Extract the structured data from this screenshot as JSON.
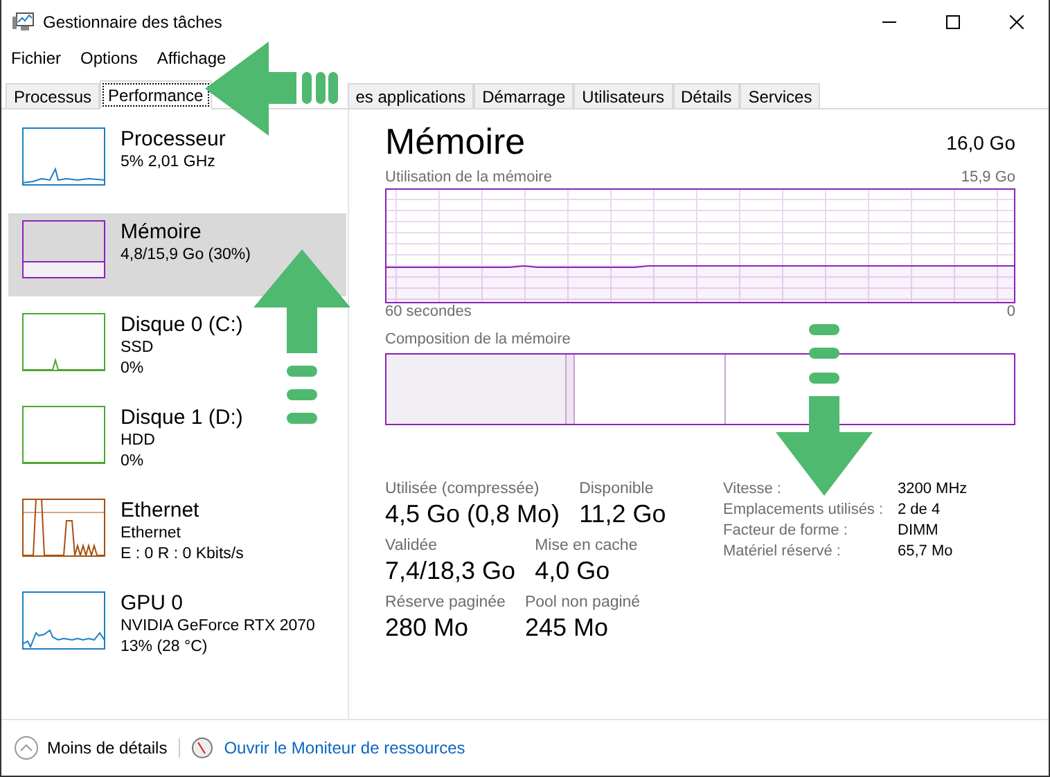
{
  "window": {
    "title": "Gestionnaire des tâches"
  },
  "menu": [
    "Fichier",
    "Options",
    "Affichage"
  ],
  "tabs": [
    {
      "label": "Processus",
      "selected": false
    },
    {
      "label": "Performance",
      "selected": true
    },
    {
      "label": "es applications",
      "selected": false
    },
    {
      "label": "Démarrage",
      "selected": false
    },
    {
      "label": "Utilisateurs",
      "selected": false
    },
    {
      "label": "Détails",
      "selected": false
    },
    {
      "label": "Services",
      "selected": false
    }
  ],
  "sidebar": {
    "items": [
      {
        "name": "Processeur",
        "lines": [
          "5%  2,01 GHz"
        ],
        "color": "#1c7fc4",
        "selected": false
      },
      {
        "name": "Mémoire",
        "lines": [
          "4,8/15,9 Go (30%)"
        ],
        "color": "#8b22b8",
        "selected": true
      },
      {
        "name": "Disque 0 (C:)",
        "lines": [
          "SSD",
          "0%"
        ],
        "color": "#4ea72e",
        "selected": false
      },
      {
        "name": "Disque 1 (D:)",
        "lines": [
          "HDD",
          "0%"
        ],
        "color": "#4ea72e",
        "selected": false
      },
      {
        "name": "Ethernet",
        "lines": [
          "Ethernet",
          "E : 0 R : 0 Kbits/s"
        ],
        "color": "#a74f0f",
        "selected": false
      },
      {
        "name": "GPU 0",
        "lines": [
          "NVIDIA GeForce RTX 2070",
          "13%  (28 °C)"
        ],
        "color": "#1c7fc4",
        "selected": false
      }
    ]
  },
  "detail": {
    "title": "Mémoire",
    "total": "16,0 Go",
    "usage_label": "Utilisation de la mémoire",
    "usage_max": "15,9 Go",
    "time_label": "60 secondes",
    "time_end": "0",
    "composition_label": "Composition de la mémoire",
    "stats": [
      [
        {
          "label": "Utilisée (compressée)",
          "value": "4,5 Go (0,8 Mo)"
        },
        {
          "label": "Disponible",
          "value": "11,2 Go"
        }
      ],
      [
        {
          "label": "Validée",
          "value": "7,4/18,3 Go"
        },
        {
          "label": "Mise en cache",
          "value": "4,0 Go"
        }
      ],
      [
        {
          "label": "Réserve paginée",
          "value": "280 Mo"
        },
        {
          "label": "Pool non paginé",
          "value": "245 Mo"
        }
      ]
    ],
    "specs": [
      {
        "label": "Vitesse :",
        "value": "3200 MHz"
      },
      {
        "label": "Emplacements utilisés :",
        "value": "2 de 4"
      },
      {
        "label": "Facteur de forme :",
        "value": "DIMM"
      },
      {
        "label": "Matériel réservé :",
        "value": "65,7 Mo"
      }
    ]
  },
  "footer": {
    "less": "Moins de détails",
    "link": "Ouvrir le Moniteur de ressources"
  }
}
